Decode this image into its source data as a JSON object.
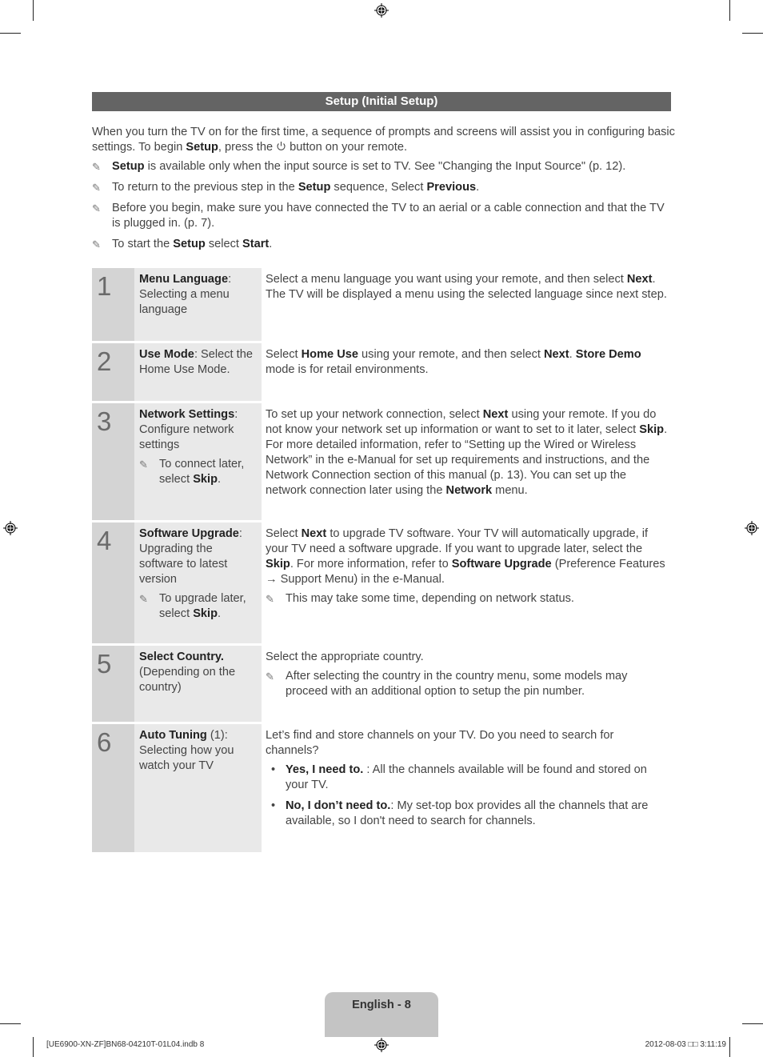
{
  "header": {
    "title": "Setup (Initial Setup)"
  },
  "intro": {
    "paragraph": [
      {
        "t": "When you turn the TV on for the first time, a sequence of prompts and screens will assist you in configuring basic settings. To begin "
      },
      {
        "b": "Setup"
      },
      {
        "t": ", press the "
      },
      {
        "icon": "power"
      },
      {
        "t": " button on your remote."
      }
    ],
    "notes": [
      [
        {
          "b": "Setup"
        },
        {
          "t": " is available only when the input source is set to TV. See \"Changing the Input Source\" (p. 12)."
        }
      ],
      [
        {
          "t": "To return to the previous step in the "
        },
        {
          "b": "Setup"
        },
        {
          "t": " sequence, Select "
        },
        {
          "b": "Previous"
        },
        {
          "t": "."
        }
      ],
      [
        {
          "t": "Before you begin, make sure you have connected the TV to an aerial or a cable connection and that the TV is plugged in. (p. 7)."
        }
      ],
      [
        {
          "t": "To start the "
        },
        {
          "b": "Setup"
        },
        {
          "t": " select "
        },
        {
          "b": "Start"
        },
        {
          "t": "."
        }
      ]
    ]
  },
  "steps": [
    {
      "number": "1",
      "name": [
        {
          "b": "Menu Language"
        },
        {
          "t": ": Selecting a menu language"
        }
      ],
      "name_note": null,
      "desc": [
        [
          {
            "t": "Select a menu language you want using your remote, and then select "
          },
          {
            "b": "Next"
          },
          {
            "t": ". The TV will be displayed a menu using the selected language since next step."
          }
        ]
      ],
      "desc_notes": [],
      "bullets": [],
      "min_height": 91
    },
    {
      "number": "2",
      "name": [
        {
          "b": "Use Mode"
        },
        {
          "t": ": Select the Home Use Mode."
        }
      ],
      "name_note": null,
      "desc": [
        [
          {
            "t": "Select "
          },
          {
            "b": "Home Use"
          },
          {
            "t": " using your remote, and then select "
          },
          {
            "b": "Next"
          },
          {
            "t": ". "
          },
          {
            "b": "Store Demo"
          },
          {
            "t": " mode is for retail environments."
          }
        ]
      ],
      "desc_notes": [],
      "bullets": [],
      "min_height": 72
    },
    {
      "number": "3",
      "name": [
        {
          "b": "Network Settings"
        },
        {
          "t": ": Configure network settings"
        }
      ],
      "name_note": [
        {
          "t": "To connect later, select "
        },
        {
          "b": "Skip"
        },
        {
          "t": "."
        }
      ],
      "desc": [
        [
          {
            "t": "To set up your network connection, select "
          },
          {
            "b": "Next"
          },
          {
            "t": " using your remote. If you do not know your network set up information or want to set to it later, select "
          },
          {
            "b": "Skip"
          },
          {
            "t": ". For more detailed information, refer to “Setting up the Wired or Wireless Network” in the e-Manual for set up requirements and instructions, and the Network Connection section of this manual (p. 13). You can set up the network connection later using the "
          },
          {
            "b": "Network"
          },
          {
            "t": " menu."
          }
        ]
      ],
      "desc_notes": [],
      "bullets": [],
      "min_height": 146
    },
    {
      "number": "4",
      "name": [
        {
          "b": "Software Upgrade"
        },
        {
          "t": ": Upgrading the software to latest version"
        }
      ],
      "name_note": [
        {
          "t": "To upgrade later, select "
        },
        {
          "b": "Skip"
        },
        {
          "t": "."
        }
      ],
      "desc": [
        [
          {
            "t": "Select "
          },
          {
            "b": "Next"
          },
          {
            "t": " to upgrade TV software. Your TV will automatically upgrade, if your TV need a software upgrade. If you want to upgrade later, select the "
          },
          {
            "b": "Skip"
          },
          {
            "t": ". For more information, refer to "
          },
          {
            "b": "Software Upgrade"
          },
          {
            "t": " (Preference Features → Support Menu) in the e-Manual."
          }
        ]
      ],
      "desc_notes": [
        [
          {
            "t": "This may take some time, depending on network status."
          }
        ]
      ],
      "bullets": [],
      "min_height": 151
    },
    {
      "number": "5",
      "name": [
        {
          "b": "Select Country."
        },
        {
          "t": " (Depending on the country)"
        }
      ],
      "name_note": null,
      "desc": [
        [
          {
            "t": "Select the appropriate country."
          }
        ]
      ],
      "desc_notes": [
        [
          {
            "t": "After selecting the country in the country menu, some models may proceed with an additional option to setup the pin number."
          }
        ]
      ],
      "bullets": [],
      "min_height": 95
    },
    {
      "number": "6",
      "name": [
        {
          "b": "Auto Tuning"
        },
        {
          "t": " (1): Selecting how you watch your TV"
        }
      ],
      "name_note": null,
      "desc": [
        [
          {
            "t": "Let’s find and store channels on your TV. Do you need to search for channels?"
          }
        ]
      ],
      "desc_notes": [],
      "bullets": [
        [
          {
            "b": "Yes, I need to."
          },
          {
            "t": " : All the channels available will be found and stored on your TV."
          }
        ],
        [
          {
            "b": "No, I don’t need to."
          },
          {
            "t": ": My set-top box provides all the channels that are available, so I don't need to search for channels."
          }
        ]
      ],
      "min_height": 160
    }
  ],
  "footer": {
    "page_label": "English - 8",
    "file_info": "[UE6900-XN-ZF]BN68-04210T-01L04.indb   8",
    "timestamp": "2012-08-03   □□ 3:11:19"
  },
  "colors": {
    "title_bar": "#646464",
    "step_number_bg": "#d4d4d4",
    "step_name_bg": "#e9e9e9",
    "page_tab": "#c4c4c4"
  }
}
